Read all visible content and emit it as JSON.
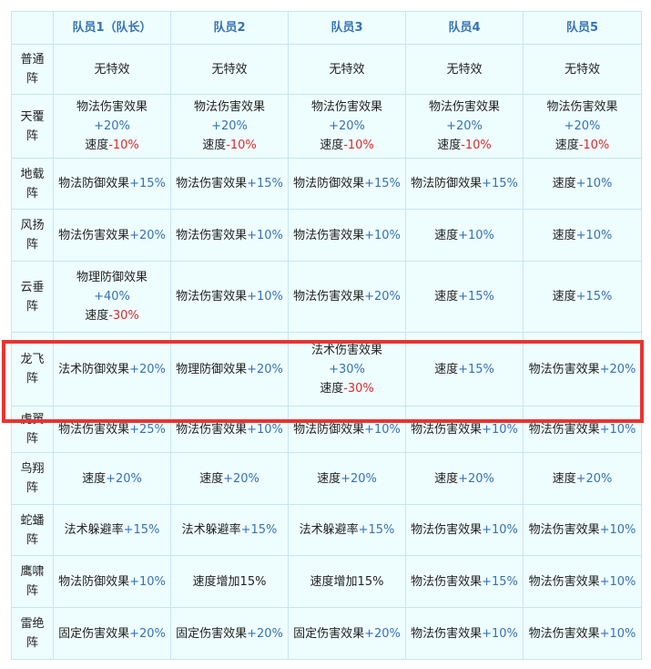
{
  "headers": [
    "",
    "队员1（队长）",
    "队员2",
    "队员3",
    "队员4",
    "队员5"
  ],
  "rows": [
    {
      "label": [
        "普通",
        "阵"
      ],
      "h": 55,
      "cells": [
        [
          [
            [
              "无特效",
              ""
            ]
          ]
        ],
        [
          [
            [
              "无特效",
              ""
            ]
          ]
        ],
        [
          [
            [
              "无特效",
              ""
            ]
          ]
        ],
        [
          [
            [
              "无特效",
              ""
            ]
          ]
        ],
        [
          [
            [
              "无特效",
              ""
            ]
          ]
        ]
      ]
    },
    {
      "label": [
        "天覆",
        "阵"
      ],
      "h": 70,
      "cells": [
        [
          [
            [
              "物法伤害效果",
              ""
            ]
          ],
          [
            [
              "+20%",
              "pos"
            ]
          ],
          [
            [
              "速度",
              ""
            ],
            [
              "-10%",
              "neg"
            ]
          ]
        ],
        [
          [
            [
              "物法伤害效果",
              ""
            ]
          ],
          [
            [
              "+20%",
              "pos"
            ]
          ],
          [
            [
              "速度",
              ""
            ],
            [
              "-10%",
              "neg"
            ]
          ]
        ],
        [
          [
            [
              "物法伤害效果",
              ""
            ]
          ],
          [
            [
              "+20%",
              "pos"
            ]
          ],
          [
            [
              "速度",
              ""
            ],
            [
              "-10%",
              "neg"
            ]
          ]
        ],
        [
          [
            [
              "物法伤害效果",
              ""
            ]
          ],
          [
            [
              "+20%",
              "pos"
            ]
          ],
          [
            [
              "速度",
              ""
            ],
            [
              "-10%",
              "neg"
            ]
          ]
        ],
        [
          [
            [
              "物法伤害效果",
              ""
            ]
          ],
          [
            [
              "+20%",
              "pos"
            ]
          ],
          [
            [
              "速度",
              ""
            ],
            [
              "-10%",
              "neg"
            ]
          ]
        ]
      ]
    },
    {
      "label": [
        "地载",
        "阵"
      ],
      "h": 56,
      "cells": [
        [
          [
            [
              "物法防御效果",
              ""
            ],
            [
              "+15%",
              "pos"
            ]
          ]
        ],
        [
          [
            [
              "物法伤害效果",
              ""
            ],
            [
              "+15%",
              "pos"
            ]
          ]
        ],
        [
          [
            [
              "物法防御效果",
              ""
            ],
            [
              "+15%",
              "pos"
            ]
          ]
        ],
        [
          [
            [
              "物法防御效果",
              ""
            ],
            [
              "+15%",
              "pos"
            ]
          ]
        ],
        [
          [
            [
              "速度",
              ""
            ],
            [
              "+10%",
              "pos"
            ]
          ]
        ]
      ]
    },
    {
      "label": [
        "风扬",
        "阵"
      ],
      "h": 57,
      "cells": [
        [
          [
            [
              "物法伤害效果",
              ""
            ],
            [
              "+20%",
              "pos"
            ]
          ]
        ],
        [
          [
            [
              "物法伤害效果",
              ""
            ],
            [
              "+10%",
              "pos"
            ]
          ]
        ],
        [
          [
            [
              "物法伤害效果",
              ""
            ],
            [
              "+10%",
              "pos"
            ]
          ]
        ],
        [
          [
            [
              "速度",
              ""
            ],
            [
              "+10%",
              "pos"
            ]
          ]
        ],
        [
          [
            [
              "速度",
              ""
            ],
            [
              "+10%",
              "pos"
            ]
          ]
        ]
      ]
    },
    {
      "label": [
        "云垂",
        "阵"
      ],
      "h": 78,
      "cells": [
        [
          [
            [
              "物理防御效果",
              ""
            ]
          ],
          [
            [
              "+40%",
              "pos"
            ]
          ],
          [
            [
              "速度",
              ""
            ],
            [
              "-30%",
              "neg"
            ]
          ]
        ],
        [
          [
            [
              "物法伤害效果",
              ""
            ],
            [
              "+10%",
              "pos"
            ]
          ]
        ],
        [
          [
            [
              "物法伤害效果",
              ""
            ],
            [
              "+20%",
              "pos"
            ]
          ]
        ],
        [
          [
            [
              "速度",
              ""
            ],
            [
              "+15%",
              "pos"
            ]
          ]
        ],
        [
          [
            [
              "速度",
              ""
            ],
            [
              "+15%",
              "pos"
            ]
          ]
        ]
      ]
    },
    {
      "label": [
        "龙飞",
        "阵"
      ],
      "h": 81,
      "cells": [
        [
          [
            [
              "法术防御效果",
              ""
            ],
            [
              "+20%",
              "pos"
            ]
          ]
        ],
        [
          [
            [
              "物理防御效果",
              ""
            ],
            [
              "+20%",
              "pos"
            ]
          ]
        ],
        [
          [
            [
              "法术伤害效果",
              ""
            ]
          ],
          [
            [
              "+30%",
              "pos"
            ]
          ],
          [
            [
              "速度",
              ""
            ],
            [
              "-30%",
              "neg"
            ]
          ]
        ],
        [
          [
            [
              "速度",
              ""
            ],
            [
              "+15%",
              "pos"
            ]
          ]
        ],
        [
          [
            [
              "物法伤害效果",
              ""
            ],
            [
              "+20%",
              "pos"
            ]
          ]
        ]
      ]
    },
    {
      "label": [
        "虎翼",
        "阵"
      ],
      "h": 51,
      "cells": [
        [
          [
            [
              "物法伤害效果",
              ""
            ],
            [
              "+25%",
              "pos"
            ]
          ]
        ],
        [
          [
            [
              "物法伤害效果",
              ""
            ],
            [
              "+10%",
              "pos"
            ]
          ]
        ],
        [
          [
            [
              "物法防御效果",
              ""
            ],
            [
              "+10%",
              "pos"
            ]
          ]
        ],
        [
          [
            [
              "物法伤害效果",
              ""
            ],
            [
              "+10%",
              "pos"
            ]
          ]
        ],
        [
          [
            [
              "物法伤害效果",
              ""
            ],
            [
              "+10%",
              "pos"
            ]
          ]
        ]
      ]
    },
    {
      "label": [
        "鸟翔",
        "阵"
      ],
      "h": 57,
      "cells": [
        [
          [
            [
              "速度",
              ""
            ],
            [
              "+20%",
              "pos"
            ]
          ]
        ],
        [
          [
            [
              "速度",
              ""
            ],
            [
              "+20%",
              "pos"
            ]
          ]
        ],
        [
          [
            [
              "速度",
              ""
            ],
            [
              "+20%",
              "pos"
            ]
          ]
        ],
        [
          [
            [
              "速度",
              ""
            ],
            [
              "+20%",
              "pos"
            ]
          ]
        ],
        [
          [
            [
              "速度",
              ""
            ],
            [
              "+20%",
              "pos"
            ]
          ]
        ]
      ]
    },
    {
      "label": [
        "蛇蟠",
        "阵"
      ],
      "h": 56,
      "cells": [
        [
          [
            [
              "法术躲避率",
              ""
            ],
            [
              "+15%",
              "pos"
            ]
          ]
        ],
        [
          [
            [
              "法术躲避率",
              ""
            ],
            [
              "+15%",
              "pos"
            ]
          ]
        ],
        [
          [
            [
              "法术躲避率",
              ""
            ],
            [
              "+15%",
              "pos"
            ]
          ]
        ],
        [
          [
            [
              "物法伤害效果",
              ""
            ],
            [
              "+10%",
              "pos"
            ]
          ]
        ],
        [
          [
            [
              "物法伤害效果",
              ""
            ],
            [
              "+10%",
              "pos"
            ]
          ]
        ]
      ]
    },
    {
      "label": [
        "鹰啸",
        "阵"
      ],
      "h": 57,
      "cells": [
        [
          [
            [
              "物法防御效果",
              ""
            ],
            [
              "+10%",
              "pos"
            ]
          ]
        ],
        [
          [
            [
              "速度增加15%",
              ""
            ]
          ]
        ],
        [
          [
            [
              "速度增加15%",
              ""
            ]
          ]
        ],
        [
          [
            [
              "物法伤害效果",
              ""
            ],
            [
              "+15%",
              "pos"
            ]
          ]
        ],
        [
          [
            [
              "物法伤害效果",
              ""
            ],
            [
              "+10%",
              "pos"
            ]
          ]
        ]
      ]
    },
    {
      "label": [
        "雷绝",
        "阵"
      ],
      "h": 57,
      "cells": [
        [
          [
            [
              "固定伤害效果",
              ""
            ],
            [
              "+20%",
              "pos"
            ]
          ]
        ],
        [
          [
            [
              "固定伤害效果",
              ""
            ],
            [
              "+20%",
              "pos"
            ]
          ]
        ],
        [
          [
            [
              "固定伤害效果",
              ""
            ],
            [
              "+20%",
              "pos"
            ]
          ]
        ],
        [
          [
            [
              "物法伤害效果",
              ""
            ],
            [
              "+10%",
              "pos"
            ]
          ]
        ],
        [
          [
            [
              "物法伤害效果",
              ""
            ],
            [
              "+10%",
              "pos"
            ]
          ]
        ]
      ]
    }
  ],
  "highlight_row": "龙飞阵"
}
